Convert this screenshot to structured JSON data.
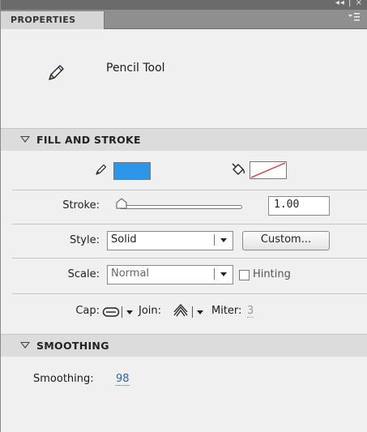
{
  "window": {
    "controls": "◂◂ | ×"
  },
  "panel": {
    "tab_label": "PROPERTIES",
    "menu_icon": "panel-menu-icon",
    "tool_name": "Pencil Tool",
    "tool_icon": "pencil-icon"
  },
  "fill_and_stroke": {
    "title": "FILL AND STROKE",
    "stroke_color": "#2f95e6",
    "fill_color": "none",
    "stroke_label": "Stroke:",
    "stroke_value": "1.00",
    "style_label": "Style:",
    "style_value": "Solid",
    "custom_button": "Custom...",
    "scale_label": "Scale:",
    "scale_value": "Normal",
    "hinting_label": "Hinting",
    "hinting_checked": false,
    "cap_label": "Cap:",
    "join_label": "Join:",
    "miter_label": "Miter:",
    "miter_value": "3"
  },
  "smoothing": {
    "title": "SMOOTHING",
    "smoothing_label": "Smoothing:",
    "smoothing_value": "98"
  }
}
